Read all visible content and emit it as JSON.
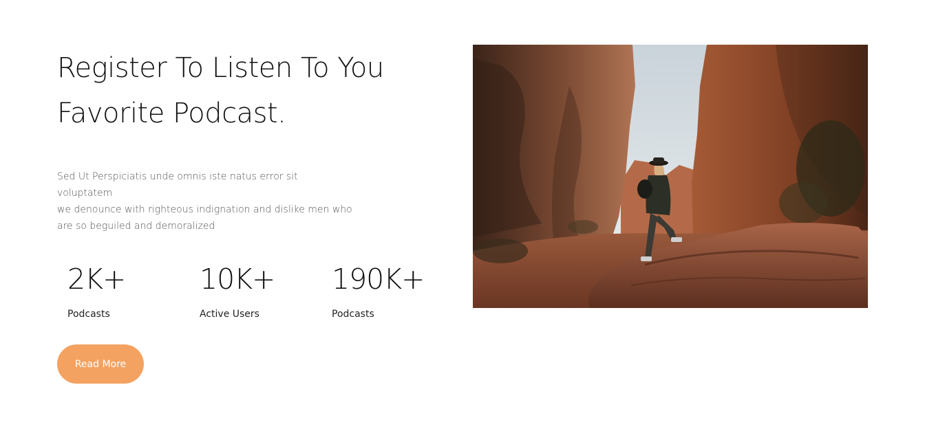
{
  "heading": {
    "line1": "Register To Listen To You",
    "line2": "Favorite Podcast."
  },
  "description": {
    "line1": "Sed Ut Perspiciatis unde omnis iste natus error sit voluptatem",
    "line2": "we denounce with righteous indignation and dislike men who",
    "line3": "are so beguiled and demoralized"
  },
  "stats": [
    {
      "value": "2K+",
      "label": "Podcasts"
    },
    {
      "value": "10K+",
      "label": "Active Users"
    },
    {
      "value": "190K+",
      "label": "Podcasts"
    }
  ],
  "cta": {
    "label": "Read More"
  },
  "colors": {
    "accent": "#f4a261",
    "heading": "#111111",
    "body_text": "#555555"
  },
  "image": {
    "subject": "hiker-in-red-rock-canyon"
  }
}
